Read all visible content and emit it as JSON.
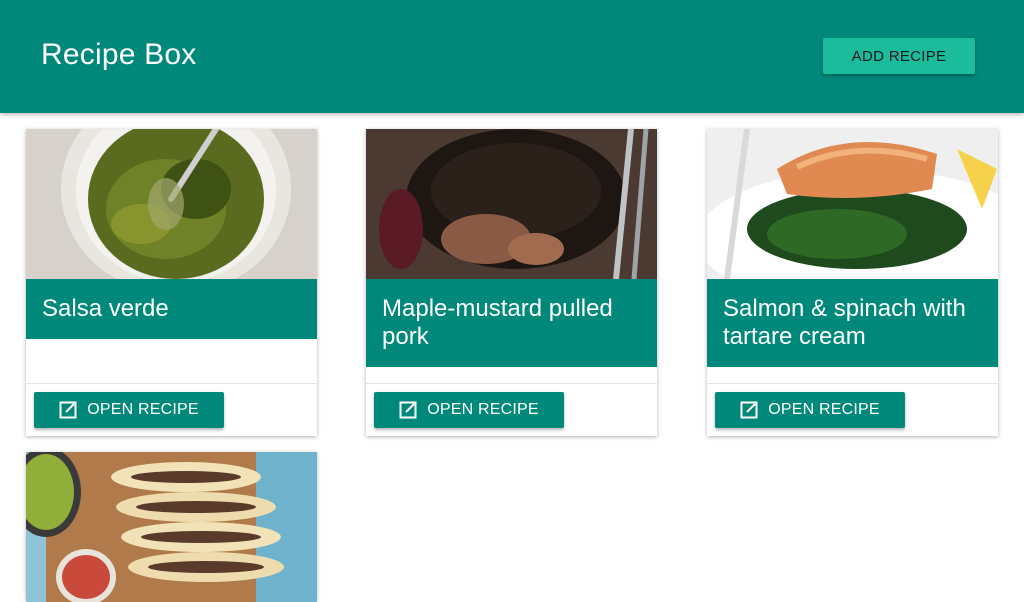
{
  "app": {
    "title": "Recipe Box",
    "add_button_label": "ADD RECIPE"
  },
  "colors": {
    "primary": "#00897b",
    "accent": "#1abc9c",
    "card_background": "#ffffff"
  },
  "recipes": [
    {
      "title": "Salsa verde",
      "image_icon": "salsa-verde-photo",
      "action_label": "OPEN RECIPE",
      "action_icon": "open-in-new-icon"
    },
    {
      "title": "Maple-mustard pulled pork",
      "image_icon": "pulled-pork-photo",
      "action_label": "OPEN RECIPE",
      "action_icon": "open-in-new-icon"
    },
    {
      "title": "Salmon & spinach with tartare cream",
      "image_icon": "salmon-spinach-photo",
      "action_label": "OPEN RECIPE",
      "action_icon": "open-in-new-icon"
    },
    {
      "title": "",
      "image_icon": "tacos-photo"
    }
  ]
}
